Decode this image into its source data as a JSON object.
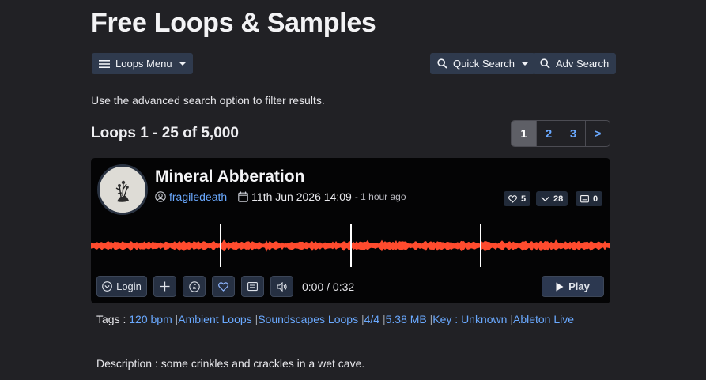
{
  "page": {
    "title": "Free Loops & Samples",
    "hint": "Use the advanced search option to filter results."
  },
  "nav": {
    "loops_menu": "Loops Menu",
    "quick_search": "Quick Search",
    "adv_search": "Adv Search"
  },
  "listing": {
    "count_text": "Loops 1 - 25 of 5,000",
    "pages": [
      "1",
      "2",
      "3",
      ">"
    ],
    "active_page": "1"
  },
  "track": {
    "title": "Mineral Abberation",
    "user": "fragiledeath",
    "date": "11th Jun 2026 14:09",
    "ago": "- 1 hour ago",
    "likes": "5",
    "downloads": "28",
    "comments": "0",
    "login_label": "Login",
    "time_display": "0:00 / 0:32",
    "play_label": "Play",
    "wave_color": "#ff4b2e"
  },
  "tags": {
    "label": "Tags :",
    "items": [
      "120 bpm",
      "Ambient Loops",
      "Soundscapes Loops",
      "4/4",
      "5.38 MB",
      "Key : Unknown",
      "Ableton Live"
    ]
  },
  "description": {
    "text": "Description : some crinkles and crackles in a wet cave."
  }
}
